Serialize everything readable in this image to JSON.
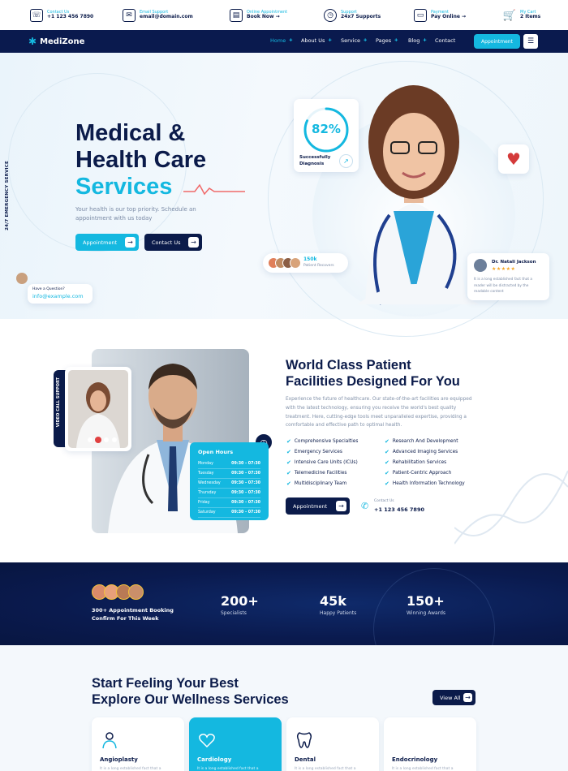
{
  "topbar": {
    "items": [
      {
        "label": "Contact Us",
        "value": "+1 123 456 7890",
        "icon": "phone-shield-icon"
      },
      {
        "label": "Email Support",
        "value": "email@domain.com",
        "icon": "mail-icon"
      },
      {
        "label": "Online Appointment",
        "value": "Book Now →",
        "icon": "clipboard-icon"
      },
      {
        "label": "Support",
        "value": "24x7 Supports",
        "icon": "clock-icon"
      },
      {
        "label": "Payment",
        "value": "Pay Online →",
        "icon": "card-icon"
      },
      {
        "label": "My Cart",
        "value": "2 Items",
        "icon": "cart-icon"
      }
    ]
  },
  "nav": {
    "logo": "MediZone",
    "menu": [
      "Home",
      "About Us",
      "Service",
      "Pages",
      "Blog",
      "Contact"
    ],
    "appointment": "Appointment",
    "accent": "#14b8e0",
    "navy": "#0a1a4e"
  },
  "hero": {
    "title_line1": "Medical &",
    "title_line2": "Health Care",
    "title_line3": "Services",
    "subtitle": "Your health is our top priority. Schedule an appointment with us today",
    "btn_appointment": "Appointment",
    "btn_contact": "Contact Us",
    "side_label": "24/7 EMERGENCY SERVICE",
    "stat_percent": "82%",
    "stat_percent_value": 82,
    "stat_caption": "Successfully Diagnosis",
    "recoveries_value": "150k",
    "recoveries_label": "Patient Recovers",
    "question_label": "Have a Question?",
    "question_email": "info@example.com",
    "review_name": "Dr. Natali Jackson",
    "review_stars": "★★★★★",
    "review_text": "It is a long established fact that a reader will be distracted by the readable content"
  },
  "facilities": {
    "title_line1": "World Class Patient",
    "title_line2": "Facilities Designed For You",
    "body": "Experience the future of healthcare. Our state-of-the-art facilities are equipped with the latest technology, ensuring you receive the world's best quality treatment. Here, cutting-edge tools meet unparalleled expertise, providing a comfortable and effective path to optimal health.",
    "features_left": [
      "Comprehensive Specialties",
      "Emergency Services",
      "Intensive Care Units (ICUs)",
      "Telemedicine Facilities",
      "Multidisciplinary Team"
    ],
    "features_right": [
      "Research And Development",
      "Advanced Imaging Services",
      "Rehabilitation Services",
      "Patient-Centric Approach",
      "Health Information Technology"
    ],
    "btn_appointment": "Appointment",
    "contact_label": "Contact Us",
    "contact_phone": "+1 123 456 7890",
    "video_label": "VIDEO CALL SUPPORT",
    "hours_title": "Open Hours",
    "hours": [
      {
        "day": "Monday",
        "time": "09:30 - 07:30"
      },
      {
        "day": "Tuesday",
        "time": "09:30 - 07:30"
      },
      {
        "day": "Wednesday",
        "time": "09:30 - 07:30"
      },
      {
        "day": "Thursday",
        "time": "09:30 - 07:30"
      },
      {
        "day": "Friday",
        "time": "09:30 - 07:30"
      },
      {
        "day": "Saturday",
        "time": "09:30 - 07:30"
      }
    ]
  },
  "stats": {
    "booking_text": "300+ Appointment Booking Confirm For This Week",
    "items": [
      {
        "value": "200+",
        "label": "Specialists"
      },
      {
        "value": "45k",
        "label": "Happy Patients"
      },
      {
        "value": "150+",
        "label": "Winning Awards"
      }
    ]
  },
  "services": {
    "title_line1": "Start Feeling Your Best",
    "title_line2": "Explore Our Wellness Services",
    "view_all": "View All",
    "desc": "It is a long established fact that a",
    "cards": [
      {
        "name": "Angioplasty",
        "icon": "doctor-icon"
      },
      {
        "name": "Cardiology",
        "icon": "heart-stethoscope-icon"
      },
      {
        "name": "Dental",
        "icon": "tooth-icon"
      },
      {
        "name": "Endocrinology",
        "icon": "gland-icon"
      }
    ]
  }
}
